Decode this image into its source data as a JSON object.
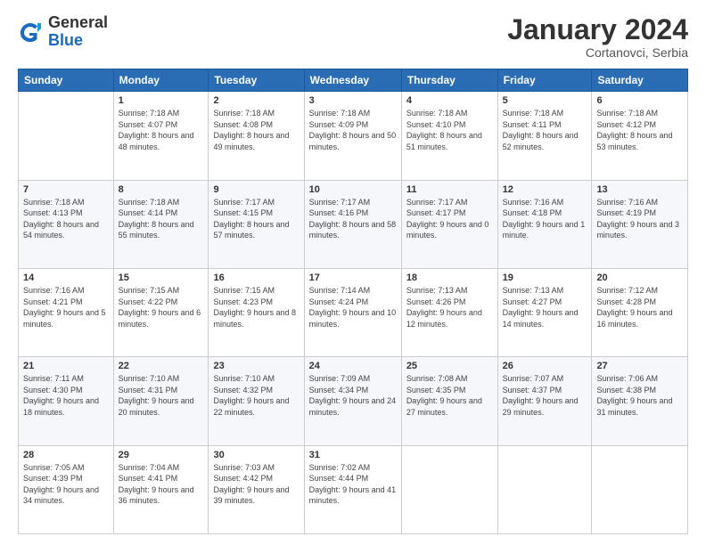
{
  "header": {
    "logo_general": "General",
    "logo_blue": "Blue",
    "month_title": "January 2024",
    "location": "Cortanovci, Serbia"
  },
  "weekdays": [
    "Sunday",
    "Monday",
    "Tuesday",
    "Wednesday",
    "Thursday",
    "Friday",
    "Saturday"
  ],
  "weeks": [
    [
      {
        "day": "",
        "sunrise": "",
        "sunset": "",
        "daylight": ""
      },
      {
        "day": "1",
        "sunrise": "Sunrise: 7:18 AM",
        "sunset": "Sunset: 4:07 PM",
        "daylight": "Daylight: 8 hours and 48 minutes."
      },
      {
        "day": "2",
        "sunrise": "Sunrise: 7:18 AM",
        "sunset": "Sunset: 4:08 PM",
        "daylight": "Daylight: 8 hours and 49 minutes."
      },
      {
        "day": "3",
        "sunrise": "Sunrise: 7:18 AM",
        "sunset": "Sunset: 4:09 PM",
        "daylight": "Daylight: 8 hours and 50 minutes."
      },
      {
        "day": "4",
        "sunrise": "Sunrise: 7:18 AM",
        "sunset": "Sunset: 4:10 PM",
        "daylight": "Daylight: 8 hours and 51 minutes."
      },
      {
        "day": "5",
        "sunrise": "Sunrise: 7:18 AM",
        "sunset": "Sunset: 4:11 PM",
        "daylight": "Daylight: 8 hours and 52 minutes."
      },
      {
        "day": "6",
        "sunrise": "Sunrise: 7:18 AM",
        "sunset": "Sunset: 4:12 PM",
        "daylight": "Daylight: 8 hours and 53 minutes."
      }
    ],
    [
      {
        "day": "7",
        "sunrise": "Sunrise: 7:18 AM",
        "sunset": "Sunset: 4:13 PM",
        "daylight": "Daylight: 8 hours and 54 minutes."
      },
      {
        "day": "8",
        "sunrise": "Sunrise: 7:18 AM",
        "sunset": "Sunset: 4:14 PM",
        "daylight": "Daylight: 8 hours and 55 minutes."
      },
      {
        "day": "9",
        "sunrise": "Sunrise: 7:17 AM",
        "sunset": "Sunset: 4:15 PM",
        "daylight": "Daylight: 8 hours and 57 minutes."
      },
      {
        "day": "10",
        "sunrise": "Sunrise: 7:17 AM",
        "sunset": "Sunset: 4:16 PM",
        "daylight": "Daylight: 8 hours and 58 minutes."
      },
      {
        "day": "11",
        "sunrise": "Sunrise: 7:17 AM",
        "sunset": "Sunset: 4:17 PM",
        "daylight": "Daylight: 9 hours and 0 minutes."
      },
      {
        "day": "12",
        "sunrise": "Sunrise: 7:16 AM",
        "sunset": "Sunset: 4:18 PM",
        "daylight": "Daylight: 9 hours and 1 minute."
      },
      {
        "day": "13",
        "sunrise": "Sunrise: 7:16 AM",
        "sunset": "Sunset: 4:19 PM",
        "daylight": "Daylight: 9 hours and 3 minutes."
      }
    ],
    [
      {
        "day": "14",
        "sunrise": "Sunrise: 7:16 AM",
        "sunset": "Sunset: 4:21 PM",
        "daylight": "Daylight: 9 hours and 5 minutes."
      },
      {
        "day": "15",
        "sunrise": "Sunrise: 7:15 AM",
        "sunset": "Sunset: 4:22 PM",
        "daylight": "Daylight: 9 hours and 6 minutes."
      },
      {
        "day": "16",
        "sunrise": "Sunrise: 7:15 AM",
        "sunset": "Sunset: 4:23 PM",
        "daylight": "Daylight: 9 hours and 8 minutes."
      },
      {
        "day": "17",
        "sunrise": "Sunrise: 7:14 AM",
        "sunset": "Sunset: 4:24 PM",
        "daylight": "Daylight: 9 hours and 10 minutes."
      },
      {
        "day": "18",
        "sunrise": "Sunrise: 7:13 AM",
        "sunset": "Sunset: 4:26 PM",
        "daylight": "Daylight: 9 hours and 12 minutes."
      },
      {
        "day": "19",
        "sunrise": "Sunrise: 7:13 AM",
        "sunset": "Sunset: 4:27 PM",
        "daylight": "Daylight: 9 hours and 14 minutes."
      },
      {
        "day": "20",
        "sunrise": "Sunrise: 7:12 AM",
        "sunset": "Sunset: 4:28 PM",
        "daylight": "Daylight: 9 hours and 16 minutes."
      }
    ],
    [
      {
        "day": "21",
        "sunrise": "Sunrise: 7:11 AM",
        "sunset": "Sunset: 4:30 PM",
        "daylight": "Daylight: 9 hours and 18 minutes."
      },
      {
        "day": "22",
        "sunrise": "Sunrise: 7:10 AM",
        "sunset": "Sunset: 4:31 PM",
        "daylight": "Daylight: 9 hours and 20 minutes."
      },
      {
        "day": "23",
        "sunrise": "Sunrise: 7:10 AM",
        "sunset": "Sunset: 4:32 PM",
        "daylight": "Daylight: 9 hours and 22 minutes."
      },
      {
        "day": "24",
        "sunrise": "Sunrise: 7:09 AM",
        "sunset": "Sunset: 4:34 PM",
        "daylight": "Daylight: 9 hours and 24 minutes."
      },
      {
        "day": "25",
        "sunrise": "Sunrise: 7:08 AM",
        "sunset": "Sunset: 4:35 PM",
        "daylight": "Daylight: 9 hours and 27 minutes."
      },
      {
        "day": "26",
        "sunrise": "Sunrise: 7:07 AM",
        "sunset": "Sunset: 4:37 PM",
        "daylight": "Daylight: 9 hours and 29 minutes."
      },
      {
        "day": "27",
        "sunrise": "Sunrise: 7:06 AM",
        "sunset": "Sunset: 4:38 PM",
        "daylight": "Daylight: 9 hours and 31 minutes."
      }
    ],
    [
      {
        "day": "28",
        "sunrise": "Sunrise: 7:05 AM",
        "sunset": "Sunset: 4:39 PM",
        "daylight": "Daylight: 9 hours and 34 minutes."
      },
      {
        "day": "29",
        "sunrise": "Sunrise: 7:04 AM",
        "sunset": "Sunset: 4:41 PM",
        "daylight": "Daylight: 9 hours and 36 minutes."
      },
      {
        "day": "30",
        "sunrise": "Sunrise: 7:03 AM",
        "sunset": "Sunset: 4:42 PM",
        "daylight": "Daylight: 9 hours and 39 minutes."
      },
      {
        "day": "31",
        "sunrise": "Sunrise: 7:02 AM",
        "sunset": "Sunset: 4:44 PM",
        "daylight": "Daylight: 9 hours and 41 minutes."
      },
      {
        "day": "",
        "sunrise": "",
        "sunset": "",
        "daylight": ""
      },
      {
        "day": "",
        "sunrise": "",
        "sunset": "",
        "daylight": ""
      },
      {
        "day": "",
        "sunrise": "",
        "sunset": "",
        "daylight": ""
      }
    ]
  ]
}
